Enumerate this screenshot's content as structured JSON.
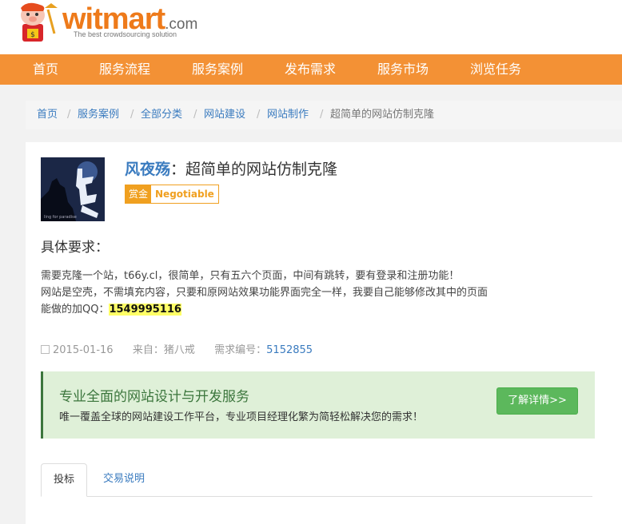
{
  "header": {
    "logo": {
      "brand": "witmart",
      "domain": ".com",
      "tagline": "The best crowdsourcing solution"
    }
  },
  "nav": {
    "items": [
      "首页",
      "服务流程",
      "服务案例",
      "发布需求",
      "服务市场",
      "浏览任务"
    ]
  },
  "breadcrumb": [
    "首页",
    "服务案例",
    "全部分类",
    "网站建设",
    "网站制作",
    "超简单的网站仿制克隆"
  ],
  "task": {
    "author": "风夜殇",
    "title_sep": "：",
    "title": "超简单的网站仿制克隆",
    "reward_label": "赏金",
    "reward_value": "Negotiable",
    "avatar_text": "ling for paradise",
    "requirements_heading": "具体要求：",
    "requirements": [
      "需要克隆一个站，t66y.cl，很简单，只有五六个页面，中间有跳转，要有登录和注册功能！",
      "网站是空壳，不需填充内容，只要和原网站效果功能界面完全一样，我要自己能够修改其中的页面"
    ],
    "contact_prefix": "能做的加QQ：",
    "contact_qq": "1549995116",
    "meta": {
      "date": "2015-01-16",
      "source": "来自：猪八戒",
      "id_label": "需求编号：",
      "id_value": "5152855"
    }
  },
  "promo": {
    "title": "专业全面的网站设计与开发服务",
    "desc": "唯一覆盖全球的网站建设工作平台，专业项目经理化繁为简轻松解决您的需求！",
    "button": "了解详情>>"
  },
  "tabs": [
    "投标",
    "交易说明"
  ],
  "colors": {
    "nav_bg": "#f39135",
    "link": "#3a7bbf",
    "reward": "#f0a020",
    "promo_bg": "#dff0d8",
    "promo_accent": "#3c763d",
    "button": "#5cb85c",
    "highlight": "#ffff66"
  }
}
